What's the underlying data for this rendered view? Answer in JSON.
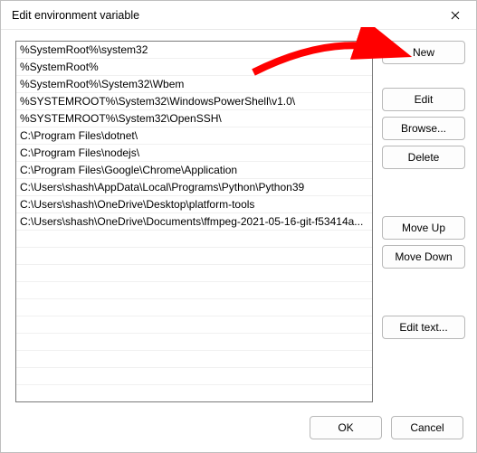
{
  "window": {
    "title": "Edit environment variable"
  },
  "list": {
    "items": [
      "%SystemRoot%\\system32",
      "%SystemRoot%",
      "%SystemRoot%\\System32\\Wbem",
      "%SYSTEMROOT%\\System32\\WindowsPowerShell\\v1.0\\",
      "%SYSTEMROOT%\\System32\\OpenSSH\\",
      "C:\\Program Files\\dotnet\\",
      "C:\\Program Files\\nodejs\\",
      "C:\\Program Files\\Google\\Chrome\\Application",
      "C:\\Users\\shash\\AppData\\Local\\Programs\\Python\\Python39",
      "C:\\Users\\shash\\OneDrive\\Desktop\\platform-tools",
      "C:\\Users\\shash\\OneDrive\\Documents\\ffmpeg-2021-05-16-git-f53414a..."
    ]
  },
  "buttons": {
    "new": "New",
    "edit": "Edit",
    "browse": "Browse...",
    "delete": "Delete",
    "move_up": "Move Up",
    "move_down": "Move Down",
    "edit_text": "Edit text...",
    "ok": "OK",
    "cancel": "Cancel"
  },
  "annotation": {
    "arrow_color": "#ff0000",
    "points_to": "new-button"
  }
}
